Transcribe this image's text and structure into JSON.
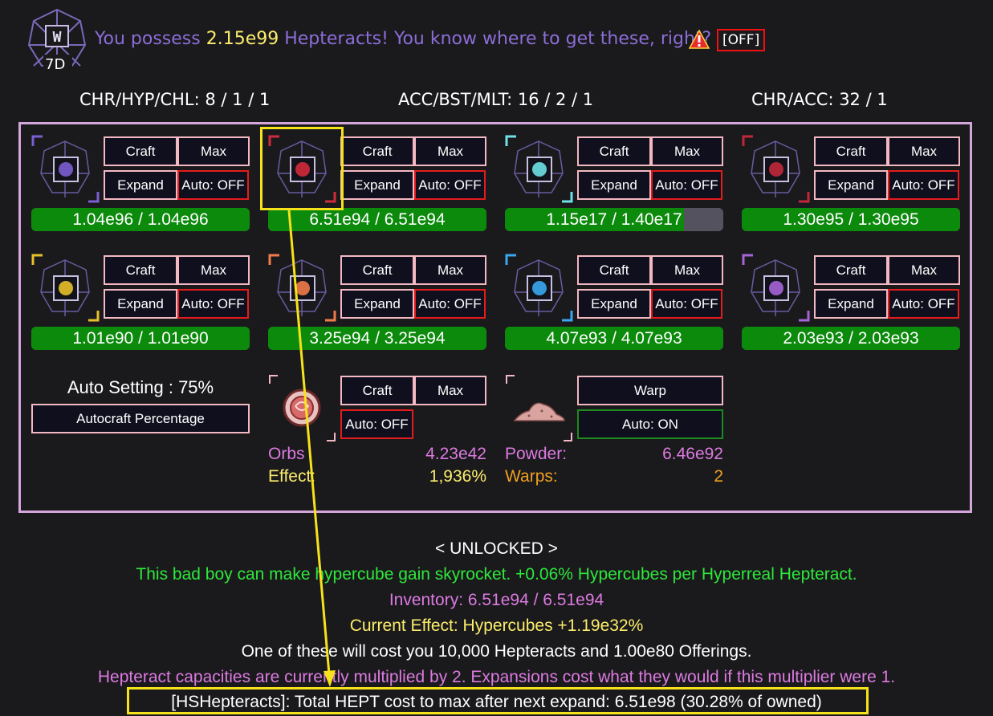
{
  "header": {
    "logo_label": "7D",
    "possess_prefix": "You possess ",
    "possess_amount": "2.15e99",
    "possess_suffix": " Hepteracts! You know where to get these, right?",
    "toggle_label": "[OFF]"
  },
  "ratios": {
    "chr_hyp_chl": "CHR/HYP/CHL: 8 / 1 / 1",
    "acc_bst_mlt": "ACC/BST/MLT: 16 / 2 / 1",
    "chr_acc": "CHR/ACC: 32 / 1"
  },
  "hepteracts": [
    {
      "icon": "chronos-hepteract-icon",
      "craft": "Craft",
      "max": "Max",
      "expand": "Expand",
      "auto": "Auto: OFF",
      "progress": "1.04e96 / 1.04e96",
      "fill": 1.0,
      "accent": "#7c5ed3"
    },
    {
      "icon": "hyperreal-hepteract-icon",
      "craft": "Craft",
      "max": "Max",
      "expand": "Expand",
      "auto": "Auto: OFF",
      "progress": "6.51e94 / 6.51e94",
      "fill": 1.0,
      "accent": "#d12a3a"
    },
    {
      "icon": "challenge-hepteract-icon",
      "craft": "Craft",
      "max": "Max",
      "expand": "Expand",
      "auto": "Auto: OFF",
      "progress": "1.15e17 / 1.40e17",
      "fill": 0.82,
      "accent": "#6ee0e6"
    },
    {
      "icon": "abyss-hepteract-icon",
      "craft": "Craft",
      "max": "Max",
      "expand": "Expand",
      "auto": "Auto: OFF",
      "progress": "1.30e95 / 1.30e95",
      "fill": 1.0,
      "accent": "#c0283a"
    },
    {
      "icon": "quark-hepteract-icon",
      "craft": "Craft",
      "max": "Max",
      "expand": "Expand",
      "auto": "Auto: OFF",
      "progress": "1.01e90 / 1.01e90",
      "fill": 1.0,
      "accent": "#e8c02a"
    },
    {
      "icon": "accelerator-hepteract-icon",
      "craft": "Craft",
      "max": "Max",
      "expand": "Expand",
      "auto": "Auto: OFF",
      "progress": "3.25e94 / 3.25e94",
      "fill": 1.0,
      "accent": "#f07c4a"
    },
    {
      "icon": "boost-hepteract-icon",
      "craft": "Craft",
      "max": "Max",
      "expand": "Expand",
      "auto": "Auto: OFF",
      "progress": "4.07e93 / 4.07e93",
      "fill": 1.0,
      "accent": "#3aa7f0"
    },
    {
      "icon": "multiplier-hepteract-icon",
      "craft": "Craft",
      "max": "Max",
      "expand": "Expand",
      "auto": "Auto: OFF",
      "progress": "2.03e93 / 2.03e93",
      "fill": 1.0,
      "accent": "#a764d8"
    }
  ],
  "auto_setting": {
    "label": "Auto Setting : 75%",
    "button": "Autocraft Percentage"
  },
  "orbs": {
    "craft": "Craft",
    "max": "Max",
    "auto": "Auto: OFF",
    "orbs_label": "Orbs",
    "orbs_value": "4.23e42",
    "effect_label": "Effect:",
    "effect_value": "1,936%"
  },
  "powder": {
    "warp": "Warp",
    "auto": "Auto: ON",
    "powder_label": "Powder:",
    "powder_value": "6.46e92",
    "warps_label": "Warps:",
    "warps_value": "2"
  },
  "info": {
    "unlocked": "< UNLOCKED >",
    "description": "This bad boy can make hypercube gain skyrocket. +0.06% Hypercubes per Hyperreal Hepteract.",
    "inventory": "Inventory: 6.51e94 / 6.51e94",
    "effect": "Current Effect: Hypercubes +1.19e32%",
    "cost": "One of these will cost you 10,000 Hepteracts and 1.00e80 Offerings.",
    "capacity": "Hepteract capacities are currently multiplied by 2. Expansions cost what they would if this multiplier were 1.",
    "hs": "[HSHepteracts]: Total HEPT cost to max after next expand: 6.51e98 (30.28% of owned)"
  },
  "colors": {
    "purple_text": "#8c6dd6",
    "yellow_text": "#fcec6b",
    "green_text": "#2de83a",
    "pink_text": "#dc7ae0",
    "orange_text": "#f0a020",
    "bar_green": "#0c8a0c",
    "highlight": "#f5e21a"
  }
}
